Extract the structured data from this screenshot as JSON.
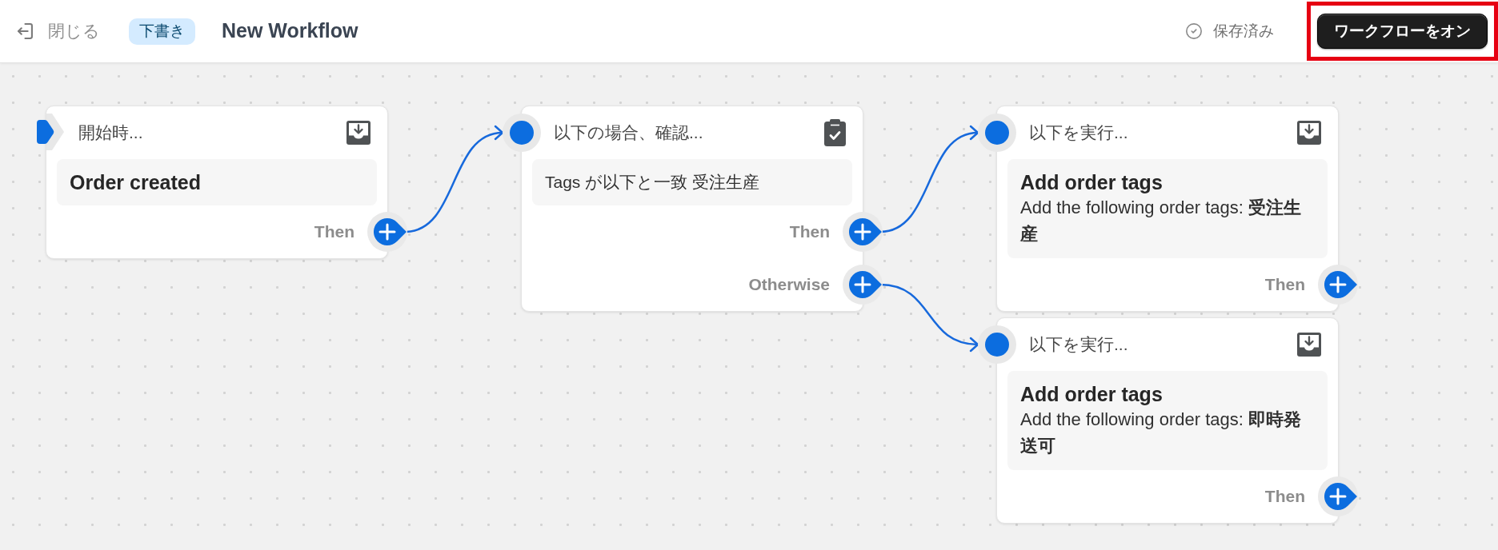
{
  "header": {
    "close_button": "閉じる",
    "status_badge": "下書き",
    "title": "New Workflow",
    "save_status": "保存済み",
    "primary_button": {
      "label": "ワークフローをオン",
      "highlighted": true
    }
  },
  "workflow": {
    "kind": "trigger",
    "title": "開始時...",
    "heading": "Order created",
    "outputs": [
      {
        "label": "Then",
        "next": {
          "kind": "condition",
          "title": "以下の場合、確認...",
          "text": "Tags が以下と一致 受注生産",
          "outputs": [
            {
              "label": "Then",
              "next": {
                "kind": "action",
                "title": "以下を実行...",
                "heading": "Add order tags",
                "text": "Add the following order tags: **受注生産**",
                "outputs": [
                  {
                    "label": "Then"
                  }
                ]
              }
            },
            {
              "label": "Otherwise",
              "next": {
                "kind": "action",
                "title": "以下を実行...",
                "heading": "Add order tags",
                "text": "Add the following order tags: **即時発送可**",
                "outputs": [
                  {
                    "label": "Then"
                  }
                ]
              }
            }
          ]
        }
      }
    ]
  }
}
